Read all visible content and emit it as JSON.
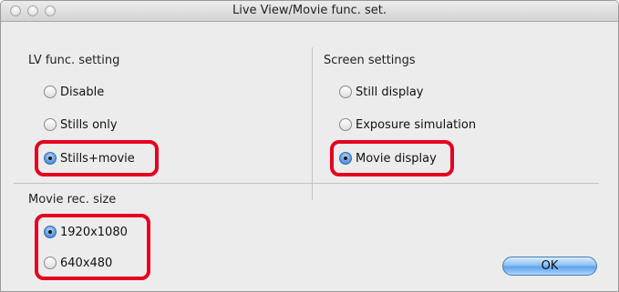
{
  "window": {
    "title": "Live View/Movie func. set."
  },
  "lv_func": {
    "heading": "LV func. setting",
    "options": [
      {
        "label": "Disable",
        "selected": false
      },
      {
        "label": "Stills only",
        "selected": false
      },
      {
        "label": "Stills+movie",
        "selected": true
      }
    ]
  },
  "screen": {
    "heading": "Screen settings",
    "options": [
      {
        "label": "Still display",
        "selected": false
      },
      {
        "label": "Exposure simulation",
        "selected": false
      },
      {
        "label": "Movie display",
        "selected": true
      }
    ]
  },
  "movie_size": {
    "heading": "Movie rec. size",
    "options": [
      {
        "label": "1920x1080",
        "selected": true
      },
      {
        "label": "640x480",
        "selected": false
      }
    ]
  },
  "buttons": {
    "ok_label": "OK"
  },
  "colors": {
    "highlight": "#e5001f",
    "accent": "#5d9be3"
  }
}
